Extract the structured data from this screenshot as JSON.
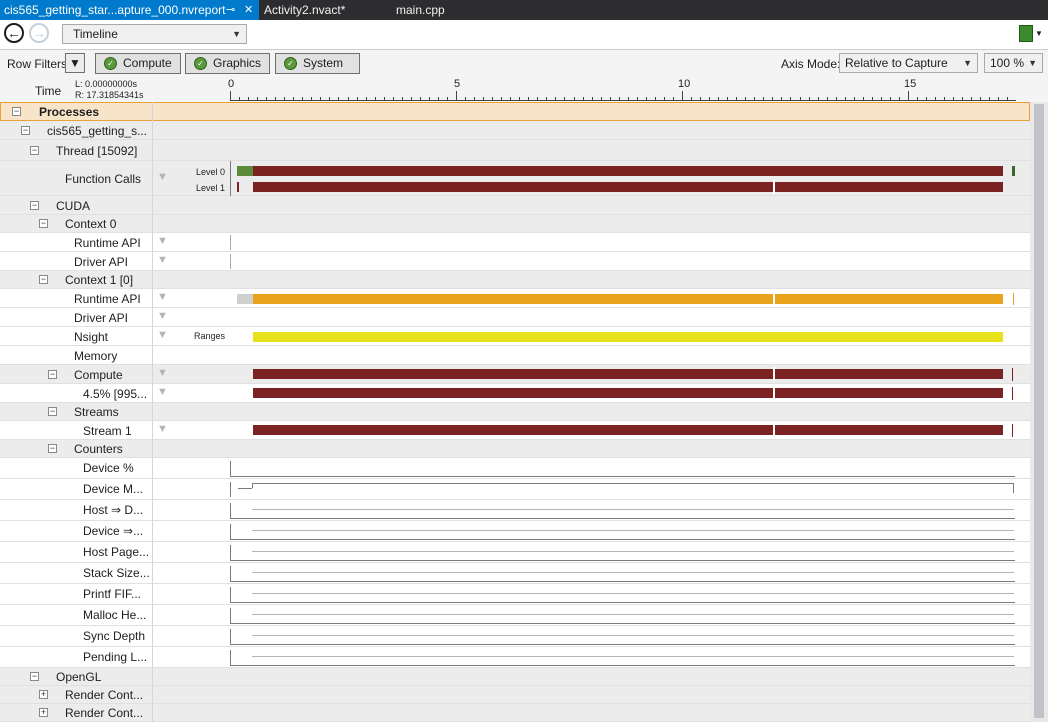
{
  "tabs": [
    {
      "label": "cis565_getting_star...apture_000.nvreport",
      "pin": "⊸",
      "close": "✕"
    },
    {
      "label": "Activity2.nvact*"
    },
    {
      "label": "main.cpp"
    }
  ],
  "toolbar": {
    "view_select": "Timeline",
    "icons": [
      "back-arrow-icon",
      "forward-arrow-icon",
      "dropdown-arrow-icon",
      "report-export-icon"
    ]
  },
  "filters": {
    "row_filters_label": "Row Filters",
    "buttons": [
      "Compute",
      "Graphics",
      "System"
    ],
    "axis_mode_label": "Axis Mode:",
    "axis_mode_value": "Relative to Capture",
    "zoom_value": "100 %"
  },
  "ruler": {
    "time_label": "Time",
    "left_value": "L: 0.00000000s",
    "right_value": "R: 17.31854341s",
    "ticks": [
      "0",
      "5",
      "10",
      "15"
    ]
  },
  "tree": {
    "processes": "Processes",
    "process_name": "cis565_getting_s...",
    "thread": "Thread [15092]",
    "function_calls": "Function Calls",
    "level0": "Level 0",
    "level1": "Level 1",
    "cuda": "CUDA",
    "context0": "Context 0",
    "runtime_api": "Runtime API",
    "driver_api": "Driver API",
    "context1": "Context 1 [0]",
    "nsight": "Nsight",
    "ranges": "Ranges",
    "memory": "Memory",
    "compute": "Compute",
    "compute_kernel": "4.5% [995...",
    "streams": "Streams",
    "stream1": "Stream 1",
    "counters": "Counters",
    "counter_names": [
      "Device %",
      "Device M...",
      "Host ⇒ D...",
      "Device ⇒...",
      "Host Page...",
      "Stack Size...",
      "Printf FIF...",
      "Malloc He...",
      "Sync Depth",
      "Pending L..."
    ],
    "opengl": "OpenGL",
    "render_context": "Render  Cont...",
    "render_context_2": "Render  Cont..."
  },
  "colors": {
    "accent_tab": "#007acc",
    "dark_red_bar": "#7b2323",
    "orange_bar": "#e8a21c",
    "yellow_bar": "#e8e21a",
    "green_marker": "#5a8a3a"
  }
}
